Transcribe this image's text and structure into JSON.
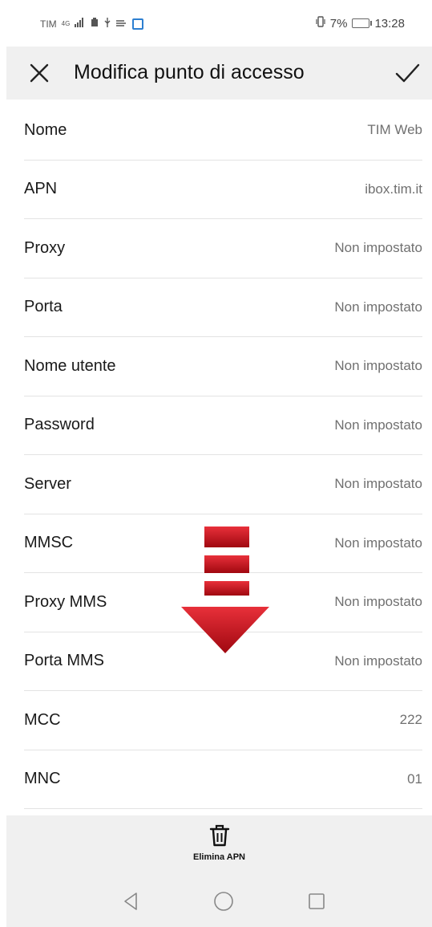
{
  "status_bar": {
    "carrier": "TIM",
    "network": "4G",
    "battery": "7%",
    "time": "13:28",
    "accent_color": "#2d7fd1"
  },
  "header": {
    "title": "Modifica punto di accesso",
    "close_icon": "close-icon",
    "confirm_icon": "checkmark-icon"
  },
  "fields": [
    {
      "label": "Nome",
      "value": "TIM Web"
    },
    {
      "label": "APN",
      "value": "ibox.tim.it"
    },
    {
      "label": "Proxy",
      "value": "Non impostato"
    },
    {
      "label": "Porta",
      "value": "Non impostato"
    },
    {
      "label": "Nome utente",
      "value": "Non impostato"
    },
    {
      "label": "Password",
      "value": "Non impostato"
    },
    {
      "label": "Server",
      "value": "Non impostato"
    },
    {
      "label": "MMSC",
      "value": "Non impostato"
    },
    {
      "label": "Proxy MMS",
      "value": "Non impostato"
    },
    {
      "label": "Porta MMS",
      "value": "Non impostato"
    },
    {
      "label": "MCC",
      "value": "222"
    },
    {
      "label": "MNC",
      "value": "01"
    }
  ],
  "overlay": {
    "icon": "scroll-down-arrow-icon",
    "color": "#c8101a"
  },
  "bottom_bar": {
    "delete_label": "Elimina APN",
    "delete_icon": "trash-icon"
  },
  "nav_bar": {
    "back_icon": "back-triangle-icon",
    "home_icon": "home-circle-icon",
    "recents_icon": "recents-square-icon"
  }
}
